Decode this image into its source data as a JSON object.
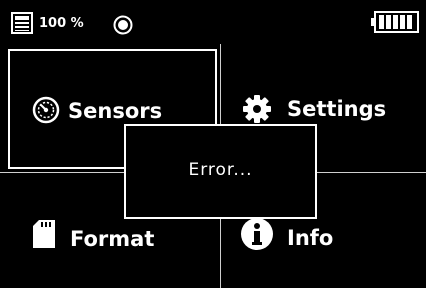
{
  "status": {
    "percent_text": "100 %",
    "battery_level": 1.0,
    "icons": [
      "document-icon",
      "record-icon",
      "battery-icon"
    ]
  },
  "menu": {
    "sensors_label": "Sensors",
    "settings_label": "Settings",
    "format_label": "Format",
    "info_label": "Info",
    "selected": "Sensors"
  },
  "dialog": {
    "message": "Error..."
  },
  "colors": {
    "background": "#000000",
    "foreground": "#ffffff",
    "divider": "#cfcfcf"
  }
}
